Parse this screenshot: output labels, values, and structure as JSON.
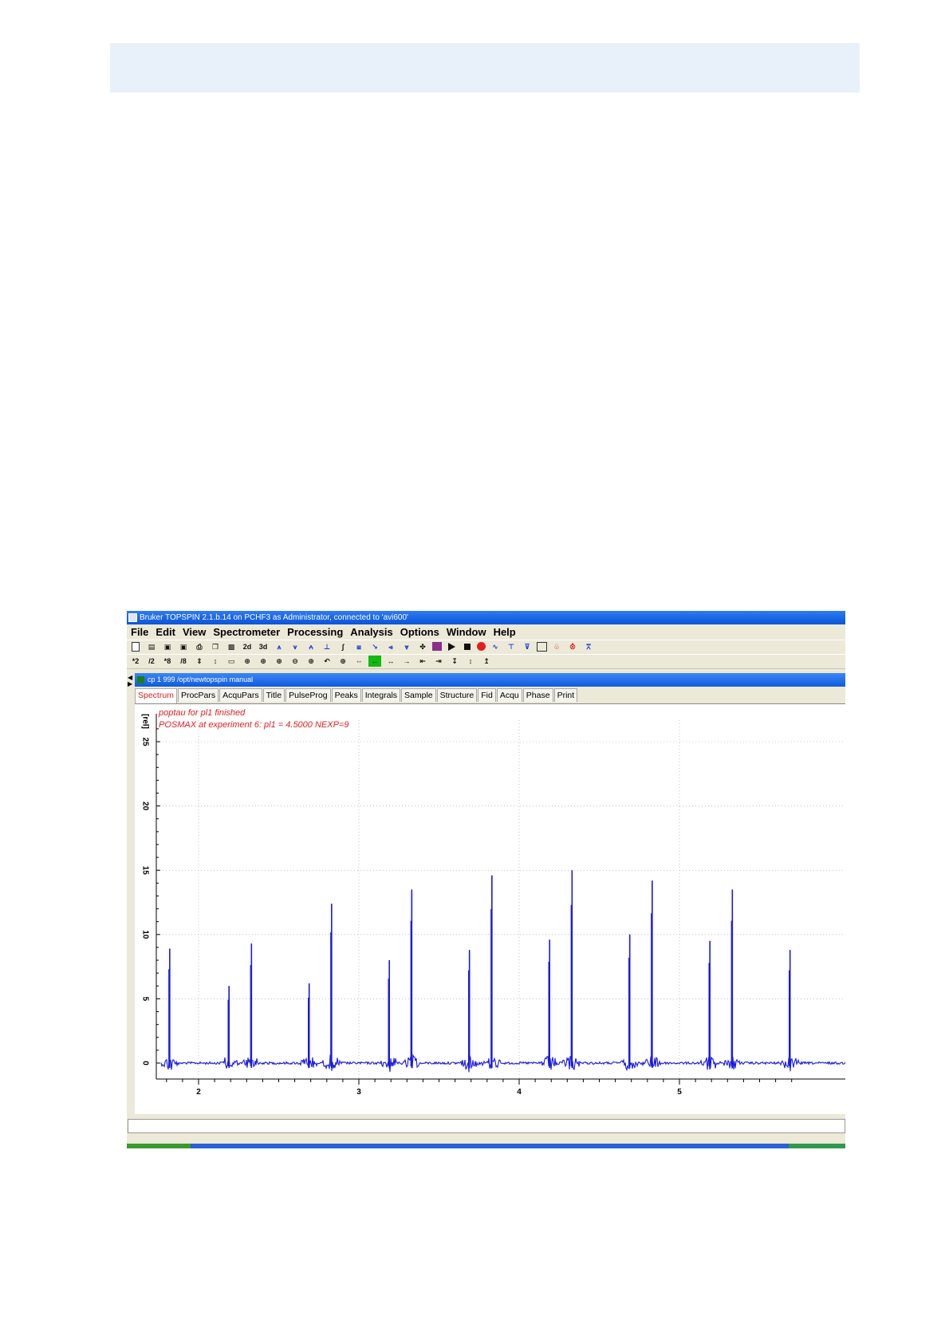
{
  "window": {
    "title": "Bruker TOPSPIN 2.1.b.14 on PCHF3 as Administrator, connected to 'avi600'"
  },
  "menu": [
    "File",
    "Edit",
    "View",
    "Spectrometer",
    "Processing",
    "Analysis",
    "Options",
    "Window",
    "Help"
  ],
  "toolbar1": [
    {
      "name": "new-icon",
      "glyph": ""
    },
    {
      "name": "open-icon",
      "glyph": "▤"
    },
    {
      "name": "save-icon",
      "glyph": "▣"
    },
    {
      "name": "save-as-icon",
      "glyph": "▣"
    },
    {
      "name": "print-icon",
      "glyph": "⎙"
    },
    {
      "name": "copy-icon",
      "glyph": "❐"
    },
    {
      "name": "export-icon",
      "glyph": "▩"
    },
    {
      "name": "2d-button",
      "glyph": "2d"
    },
    {
      "name": "3d-button",
      "glyph": "3d"
    },
    {
      "name": "phase-icon",
      "glyph": "⩚"
    },
    {
      "name": "baseline-icon",
      "glyph": "⩛"
    },
    {
      "name": "calibrate-icon",
      "glyph": "⩜"
    },
    {
      "name": "peak-pick-icon",
      "glyph": "⊥"
    },
    {
      "name": "integrate-icon",
      "glyph": "∫"
    },
    {
      "name": "multiplet-icon",
      "glyph": "⩏"
    },
    {
      "name": "deconvolution-icon",
      "glyph": "↘"
    },
    {
      "name": "multiple-display-icon",
      "glyph": "⩹"
    },
    {
      "name": "peak-overlay-icon",
      "glyph": "⩔"
    },
    {
      "name": "structure-icon",
      "glyph": "✤"
    },
    {
      "name": "acquisition-icon",
      "glyph": ""
    },
    {
      "name": "play-icon",
      "glyph": ""
    },
    {
      "name": "stop-icon",
      "glyph": ""
    },
    {
      "name": "halt-icon",
      "glyph": ""
    },
    {
      "name": "fid-icon",
      "glyph": "∿"
    },
    {
      "name": "lock-icon",
      "glyph": "⊤"
    },
    {
      "name": "shim-icon",
      "glyph": "⊽"
    },
    {
      "name": "window-icon",
      "glyph": ""
    },
    {
      "name": "spinner-icon",
      "glyph": "♧"
    },
    {
      "name": "temperature-icon",
      "glyph": "⨶"
    },
    {
      "name": "cluster-icon",
      "glyph": "⩞"
    }
  ],
  "toolbar2": [
    "*2",
    "/2",
    "*8",
    "/8",
    "⇕",
    "↕",
    "▭",
    "⊕",
    "⊕",
    "⊕",
    "⊖",
    "⊕",
    "↶",
    "⊕",
    "⇔",
    "←",
    "↔",
    "→",
    "⇤",
    "⇥",
    "↧",
    "↕",
    "↥"
  ],
  "inner_window": {
    "title": "cp  1  999  /opt/newtopspin  manual"
  },
  "tabs": [
    "Spectrum",
    "ProcPars",
    "AcquPars",
    "Title",
    "PulseProg",
    "Peaks",
    "Integrals",
    "Sample",
    "Structure",
    "Fid",
    "Acqu",
    "Phase",
    "Print"
  ],
  "messages": {
    "line1": "poptau for pl1 finished",
    "line2": "POSMAX at experiment 6:  pl1 = 4.5000    NEXP=9"
  },
  "colors": {
    "spectrum": "#1a1ae0",
    "message": "#e02020",
    "titlebar": "#0a54d8"
  },
  "chart_data": {
    "type": "line",
    "ylabel": "[rel]",
    "xlabel": "",
    "x_ticks": [
      "2",
      "3",
      "4",
      "5"
    ],
    "y_ticks": [
      "0",
      "5",
      "10",
      "15",
      "20",
      "25"
    ],
    "xlim": [
      1.58,
      5.73
    ],
    "ylim": [
      -1,
      27.5
    ],
    "grid": true,
    "series": [
      {
        "peaks": [
          {
            "x": 1.82,
            "y": 8.9
          },
          {
            "x": 2.19,
            "y": 6.0
          },
          {
            "x": 2.33,
            "y": 9.3
          },
          {
            "x": 2.69,
            "y": 6.2
          },
          {
            "x": 2.83,
            "y": 12.4
          },
          {
            "x": 3.19,
            "y": 8.0
          },
          {
            "x": 3.33,
            "y": 13.5
          },
          {
            "x": 3.69,
            "y": 8.8
          },
          {
            "x": 3.83,
            "y": 14.6
          },
          {
            "x": 4.19,
            "y": 9.6
          },
          {
            "x": 4.33,
            "y": 15.0
          },
          {
            "x": 4.69,
            "y": 10.0
          },
          {
            "x": 4.83,
            "y": 14.2
          },
          {
            "x": 5.19,
            "y": 9.5
          },
          {
            "x": 5.33,
            "y": 13.5
          },
          {
            "x": 5.69,
            "y": 8.8
          }
        ]
      }
    ]
  }
}
